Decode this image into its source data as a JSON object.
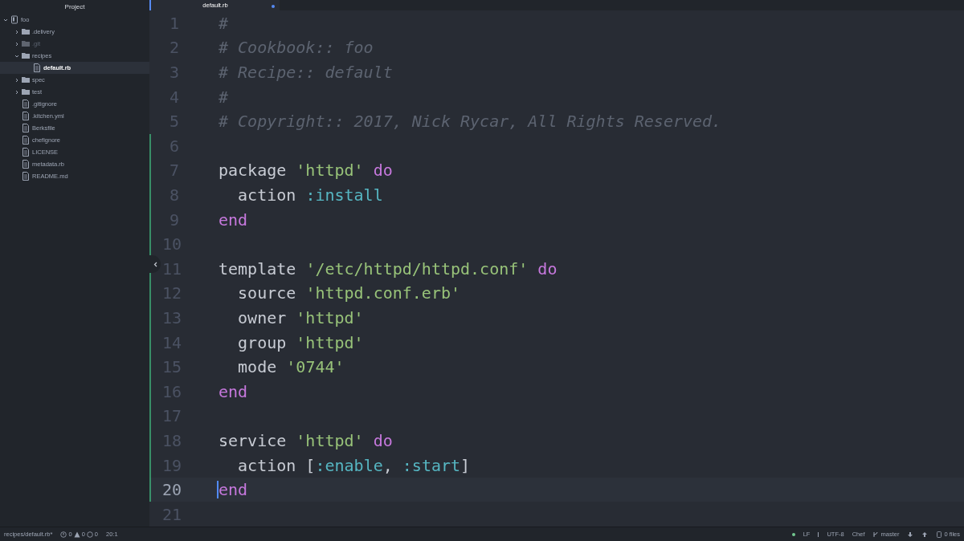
{
  "sidebar": {
    "title": "Project",
    "tree": [
      {
        "name": "foo",
        "kind": "repo",
        "expanded": true,
        "selected": false,
        "ignored": false,
        "children": [
          {
            "name": ".delivery",
            "kind": "folder",
            "expanded": false,
            "selected": false,
            "ignored": false
          },
          {
            "name": ".git",
            "kind": "folder",
            "expanded": false,
            "selected": false,
            "ignored": true
          },
          {
            "name": "recipes",
            "kind": "folder",
            "expanded": true,
            "selected": false,
            "ignored": false,
            "children": [
              {
                "name": "default.rb",
                "kind": "file",
                "selected": true,
                "ignored": false
              }
            ]
          },
          {
            "name": "spec",
            "kind": "folder",
            "expanded": false,
            "selected": false,
            "ignored": false
          },
          {
            "name": "test",
            "kind": "folder",
            "expanded": false,
            "selected": false,
            "ignored": false
          },
          {
            "name": ".gitignore",
            "kind": "file",
            "selected": false,
            "ignored": false
          },
          {
            "name": ".kitchen.yml",
            "kind": "file",
            "selected": false,
            "ignored": false
          },
          {
            "name": "Berksfile",
            "kind": "file",
            "selected": false,
            "ignored": false
          },
          {
            "name": "chefignore",
            "kind": "file",
            "selected": false,
            "ignored": false
          },
          {
            "name": "LICENSE",
            "kind": "file",
            "selected": false,
            "ignored": false
          },
          {
            "name": "metadata.rb",
            "kind": "file",
            "selected": false,
            "ignored": false
          },
          {
            "name": "README.md",
            "kind": "file",
            "selected": false,
            "ignored": false
          }
        ]
      }
    ]
  },
  "tabs": [
    {
      "label": "default.rb",
      "selected": true,
      "modified": true
    }
  ],
  "editor": {
    "lines": [
      {
        "number": "1",
        "added": false,
        "selected": false,
        "tokens": [
          {
            "kind": "comment",
            "text": "#"
          }
        ]
      },
      {
        "number": "2",
        "added": false,
        "selected": false,
        "tokens": [
          {
            "kind": "comment",
            "text": "# Cookbook:: foo"
          }
        ]
      },
      {
        "number": "3",
        "added": false,
        "selected": false,
        "tokens": [
          {
            "kind": "comment",
            "text": "# Recipe:: default"
          }
        ]
      },
      {
        "number": "4",
        "added": false,
        "selected": false,
        "tokens": [
          {
            "kind": "comment",
            "text": "#"
          }
        ]
      },
      {
        "number": "5",
        "added": false,
        "selected": false,
        "tokens": [
          {
            "kind": "comment",
            "text": "# Copyright:: 2017, Nick Rycar, All Rights Reserved."
          }
        ]
      },
      {
        "number": "6",
        "added": true,
        "selected": false
      },
      {
        "number": "7",
        "added": true,
        "selected": false,
        "tokens": [
          {
            "kind": "plain",
            "text": "package "
          },
          {
            "kind": "string",
            "text": "'httpd'"
          },
          {
            "kind": "keyword",
            "text": " do"
          }
        ]
      },
      {
        "number": "8",
        "added": true,
        "selected": false,
        "tokens": [
          {
            "kind": "plain",
            "text": "  action "
          },
          {
            "kind": "symbol",
            "text": ":install"
          }
        ]
      },
      {
        "number": "9",
        "added": true,
        "selected": false,
        "tokens": [
          {
            "kind": "keyword",
            "text": "end"
          }
        ]
      },
      {
        "number": "10",
        "added": true,
        "selected": false
      },
      {
        "number": "11",
        "added": true,
        "selected": false,
        "tokens": [
          {
            "kind": "plain",
            "text": "template "
          },
          {
            "kind": "string",
            "text": "'/etc/httpd/httpd.conf'"
          },
          {
            "kind": "keyword",
            "text": " do"
          }
        ]
      },
      {
        "number": "12",
        "added": true,
        "selected": false,
        "tokens": [
          {
            "kind": "plain",
            "text": "  source "
          },
          {
            "kind": "string",
            "text": "'httpd.conf.erb'"
          }
        ]
      },
      {
        "number": "13",
        "added": true,
        "selected": false,
        "tokens": [
          {
            "kind": "plain",
            "text": "  owner "
          },
          {
            "kind": "string",
            "text": "'httpd'"
          }
        ]
      },
      {
        "number": "14",
        "added": true,
        "selected": false,
        "tokens": [
          {
            "kind": "plain",
            "text": "  group "
          },
          {
            "kind": "string",
            "text": "'httpd'"
          }
        ]
      },
      {
        "number": "15",
        "added": true,
        "selected": false,
        "tokens": [
          {
            "kind": "plain",
            "text": "  mode "
          },
          {
            "kind": "string",
            "text": "'0744'"
          }
        ]
      },
      {
        "number": "16",
        "added": true,
        "selected": false,
        "tokens": [
          {
            "kind": "keyword",
            "text": "end"
          }
        ]
      },
      {
        "number": "17",
        "added": true,
        "selected": false
      },
      {
        "number": "18",
        "added": true,
        "selected": false,
        "tokens": [
          {
            "kind": "plain",
            "text": "service "
          },
          {
            "kind": "string",
            "text": "'httpd'"
          },
          {
            "kind": "keyword",
            "text": " do"
          }
        ]
      },
      {
        "number": "19",
        "added": true,
        "selected": false,
        "tokens": [
          {
            "kind": "plain",
            "text": "  action ["
          },
          {
            "kind": "symbol",
            "text": ":enable"
          },
          {
            "kind": "plain",
            "text": ", "
          },
          {
            "kind": "symbol",
            "text": ":start"
          },
          {
            "kind": "plain",
            "text": "]"
          }
        ]
      },
      {
        "number": "20",
        "added": true,
        "selected": true,
        "tokens": [
          {
            "kind": "keyword",
            "text": "end"
          }
        ]
      },
      {
        "number": "21",
        "added": false,
        "selected": false
      }
    ]
  },
  "status_bar": {
    "file_path": "recipes/default.rb*",
    "errors": "0",
    "warnings": "0",
    "infos": "0",
    "cursor": "20:1",
    "line_ending": "LF",
    "encoding": "UTF-8",
    "grammar": "Chef",
    "branch": "master",
    "files": "0 files"
  }
}
